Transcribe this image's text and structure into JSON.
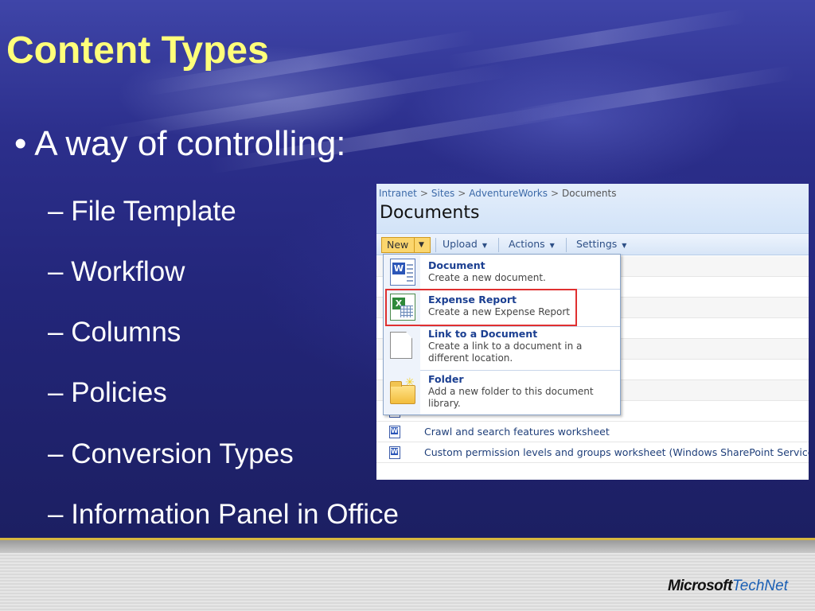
{
  "slide": {
    "title": "Content Types",
    "bullet": "• A way of controlling:",
    "sub_items": [
      "– File Template",
      "– Workflow",
      "– Columns",
      "– Policies",
      "– Conversion Types",
      "– Information Panel in Office"
    ]
  },
  "screenshot": {
    "breadcrumb": [
      "Intranet",
      "Sites",
      "AdventureWorks",
      "Documents"
    ],
    "breadcrumb_sep": ">",
    "page_title": "Documents",
    "toolbar": {
      "new_label": "New",
      "upload_label": "Upload",
      "actions_label": "Actions",
      "settings_label": "Settings"
    },
    "menu_items": [
      {
        "title": "Document",
        "desc_lines": [
          "Create a new document."
        ],
        "icon": "word-document-icon"
      },
      {
        "title": "Expense Report",
        "desc_lines": [
          "Create a new Expense Report"
        ],
        "icon": "excel-document-icon"
      },
      {
        "title": "Link to a Document",
        "desc_lines": [
          "Create a link to a document in a",
          "different location."
        ],
        "icon": "blank-document-icon"
      },
      {
        "title": "Folder",
        "desc_lines": [
          "Add a new folder to this document",
          "library."
        ],
        "icon": "folder-icon"
      }
    ],
    "list_rows": [
      "Crawl and search features worksheet",
      "Custom permission levels and groups worksheet (Windows SharePoint Services)"
    ]
  },
  "footer": {
    "logo_microsoft": "Microsoft",
    "logo_technet": "TechNet"
  },
  "colors": {
    "title": "#ffff7a",
    "accent_line": "#d8b840",
    "highlight_box": "#e03030",
    "link_blue": "#1b3f91"
  }
}
